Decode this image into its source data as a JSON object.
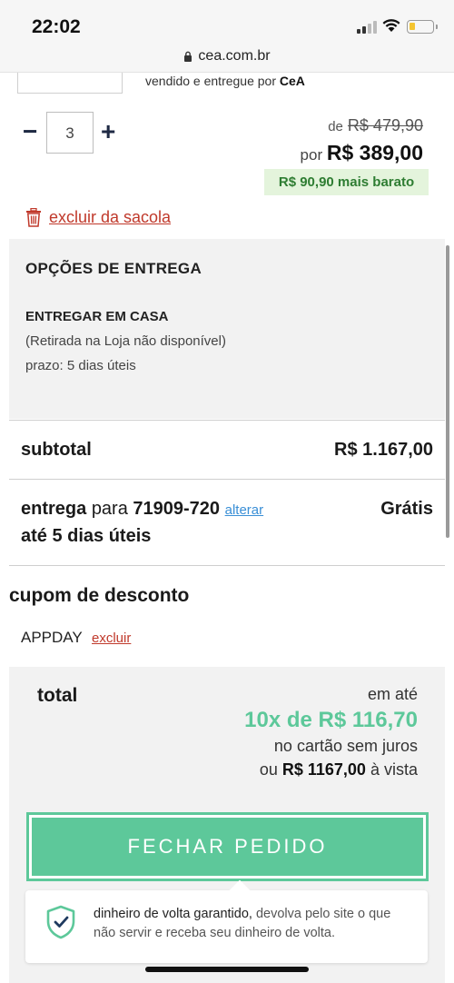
{
  "status_bar": {
    "time": "22:02"
  },
  "browser": {
    "url": "cea.com.br"
  },
  "product": {
    "sold_by_prefix": "vendido e entregue por",
    "sold_by_name": "CeA",
    "quantity": "3",
    "old_price_prefix": "de",
    "old_price": "R$ 479,90",
    "new_price_prefix": "por",
    "new_price": "R$ 389,00",
    "saving_badge": "R$ 90,90 mais barato",
    "remove_label": "excluir da sacola"
  },
  "delivery": {
    "title": "OPÇÕES DE ENTREGA",
    "option": "ENTREGAR EM CASA",
    "note": "(Retirada na Loja não disponível)",
    "term": "prazo: 5 dias úteis"
  },
  "summary": {
    "subtotal_label": "subtotal",
    "subtotal_value": "R$ 1.167,00",
    "shipping_label": "entrega",
    "shipping_to": "para",
    "zip": "71909-720",
    "change_label": "alterar",
    "shipping_eta": "até 5 dias úteis",
    "shipping_value": "Grátis"
  },
  "coupon": {
    "title": "cupom de desconto",
    "code": "APPDAY",
    "remove_label": "excluir"
  },
  "total": {
    "label": "total",
    "up_to": "em até",
    "installments": "10x de R$ 116,70",
    "card_note": "no cartão sem juros",
    "cash_prefix": "ou",
    "cash_value": "R$ 1167,00",
    "cash_suffix": "à vista",
    "checkout_label": "FECHAR PEDIDO",
    "guarantee_strong": "dinheiro de volta garantido,",
    "guarantee_rest": " devolva pelo site o que não servir e receba seu dinheiro de volta."
  },
  "colors": {
    "accent_green": "#5dc89a",
    "discount_green": "#2e7d32",
    "danger_red": "#c0392b",
    "link_blue": "#3a8fd6"
  },
  "icons": [
    "lock-icon",
    "trash-icon",
    "shield-check-icon",
    "minus-icon",
    "plus-icon",
    "wifi-icon",
    "signal-icon",
    "battery-icon"
  ]
}
